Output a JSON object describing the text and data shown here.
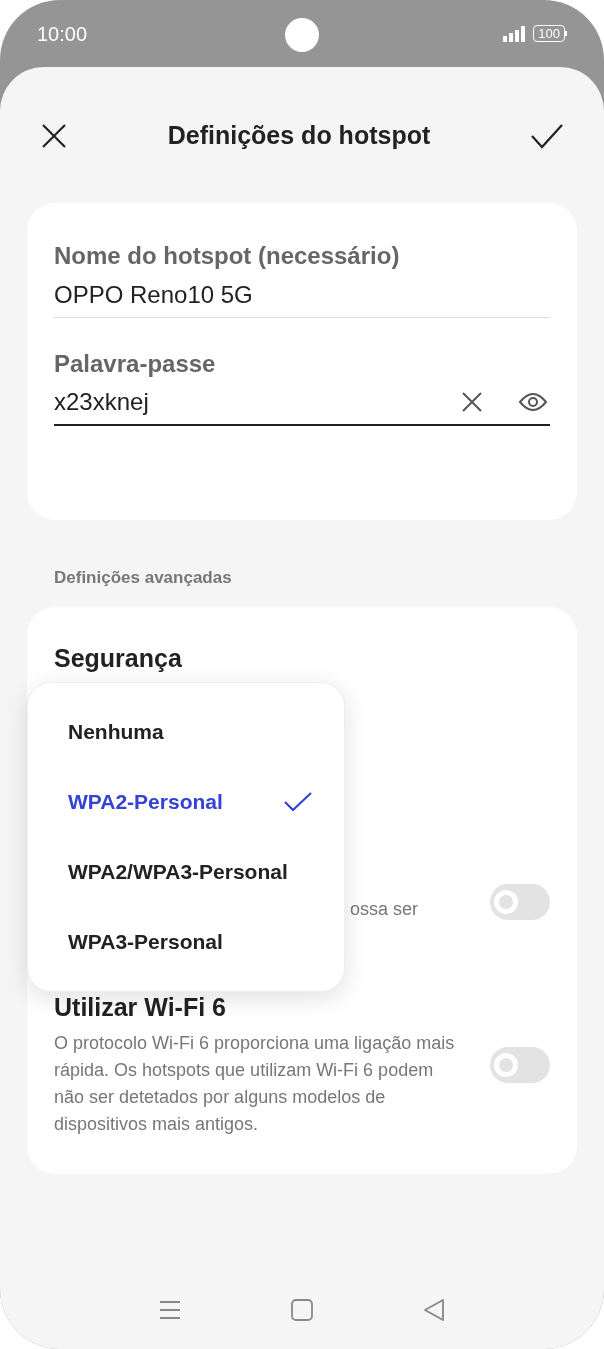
{
  "status_bar": {
    "time": "10:00",
    "battery": "100"
  },
  "header": {
    "title": "Definições do hotspot"
  },
  "fields": [
    {
      "label": "Nome do hotspot (necessário)",
      "value": "OPPO Reno10 5G",
      "kind": "text",
      "focused": false
    },
    {
      "label": "Palavra-passe",
      "value": "x23xknej",
      "kind": "password",
      "focused": true
    }
  ],
  "section_title": "Definições avançadas",
  "security": {
    "label": "Segurança",
    "options": [
      {
        "label": "Nenhuma",
        "selected": false
      },
      {
        "label": "WPA2-Personal",
        "selected": true
      },
      {
        "label": "WPA2/WPA3-Personal",
        "selected": false
      },
      {
        "label": "WPA3-Personal",
        "selected": false
      }
    ]
  },
  "toggles": [
    {
      "kind": "covered",
      "description": "ossa ser",
      "on": false
    },
    {
      "kind": "full",
      "title": "Utilizar Wi-Fi 6",
      "description": "O protocolo Wi-Fi 6 proporciona uma ligação mais rápida. Os hotspots que utilizam Wi-Fi 6 podem não ser detetados por alguns modelos de dispositivos mais antigos.",
      "on": false
    }
  ]
}
